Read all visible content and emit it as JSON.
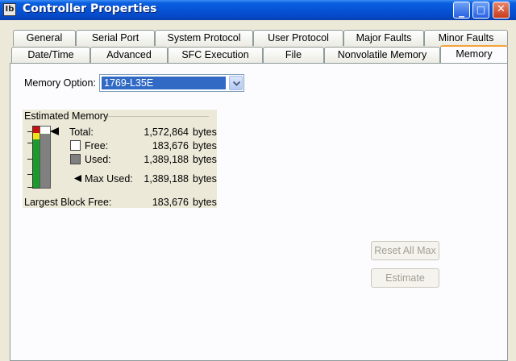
{
  "window": {
    "title": "Controller Properties",
    "icon_text": "Ib",
    "controls": {
      "minimize": "_",
      "maximize": "□",
      "close": "✕"
    }
  },
  "tabs": {
    "row_back": [
      "General",
      "Serial Port",
      "System Protocol",
      "User Protocol",
      "Major Faults",
      "Minor Faults"
    ],
    "row_front": [
      "Date/Time",
      "Advanced",
      "SFC Execution",
      "File",
      "Nonvolatile Memory",
      "Memory"
    ],
    "active": "Memory"
  },
  "memory_option": {
    "label": "Memory Option:",
    "value": "1769-L35E"
  },
  "estimated_memory": {
    "group_title": "Estimated Memory",
    "unit": "bytes",
    "total": {
      "label": "Total:",
      "value": "1,572,864"
    },
    "free": {
      "label": "Free:",
      "value": "183,676",
      "color": "#ffffff"
    },
    "used": {
      "label": "Used:",
      "value": "1,389,188",
      "color": "#808080"
    },
    "max_used": {
      "label": "Max Used:",
      "value": "1,389,188"
    },
    "largest_block_free": {
      "label": "Largest Block Free:",
      "value": "183,676"
    },
    "gauge": {
      "used_fraction": 0.883,
      "colors": {
        "red": "#cc1010",
        "yellow": "#f2e21c",
        "green": "#1a9b2c"
      }
    }
  },
  "buttons": {
    "reset_all_max": "Reset All Max",
    "estimate": "Estimate"
  }
}
